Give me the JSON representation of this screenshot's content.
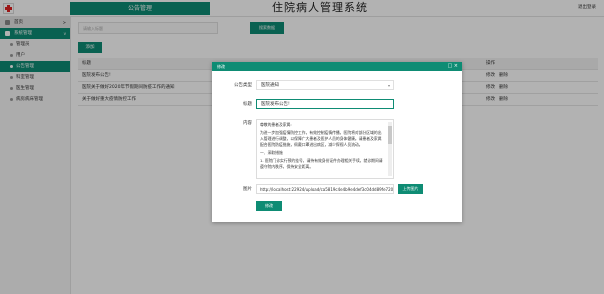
{
  "header": {
    "module_tab": "公告管理",
    "system_title": "住院病人管理系统",
    "logout": "退出登录"
  },
  "sidebar": {
    "groups": [
      {
        "label": "首页",
        "open": false
      },
      {
        "label": "系统管理",
        "open": true
      }
    ],
    "items": [
      {
        "label": "管理员"
      },
      {
        "label": "用户"
      },
      {
        "label": "公告管理"
      },
      {
        "label": "科室管理"
      },
      {
        "label": "医生管理"
      },
      {
        "label": "病房病床管理"
      }
    ]
  },
  "toolbar": {
    "search_placeholder": "请输入标题",
    "search_button": "搜索数据",
    "add_button": "添加"
  },
  "table": {
    "headers": [
      "标题",
      "操作"
    ],
    "rows": [
      {
        "title": "医院发布公告!",
        "edit": "修改",
        "delete": "删除"
      },
      {
        "title": "医院关于做好2020年节假期间防疫工作的通知",
        "edit": "修改",
        "delete": "删除"
      },
      {
        "title": "关于做好重大疫情防控工作",
        "edit": "修改",
        "delete": "删除"
      }
    ]
  },
  "modal": {
    "title": "修改",
    "labels": {
      "type": "公告类型",
      "title": "标题",
      "content": "内容",
      "image": "图片"
    },
    "type_value": "医院通知",
    "title_value": "医院发布公告!",
    "content_lines": [
      "尊敬的患者及家属:",
      "为进一步加强疫情防控工作，有效控制疫情传播，医院将对部分区域的出入管理进行调整，以保障广大患者及医护人员的身体健康。请患者及家属配合医院防疫措施，佩戴口罩进出病区，减少探视人员流动。",
      "一、采取措施",
      "1. 医院门诊实行预约挂号，请持有效身份证件办理相关手续，就诊期间请遵守院内秩序，保持安全距离。"
    ],
    "image_url": "http://localhost:22924/upload/ca5819c4e4b9e4def3c04dd89fe7201a72e.jpg",
    "upload_button": "上传图片",
    "submit_button": "修改"
  },
  "colors": {
    "primary": "#0e8c74"
  }
}
